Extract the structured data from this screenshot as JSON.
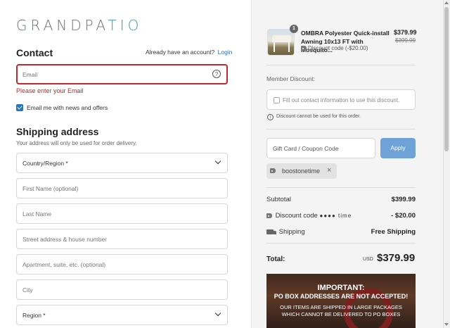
{
  "logo": {
    "text_main": "GRANDPA",
    "text_accent": "TIO"
  },
  "contact": {
    "title": "Contact",
    "already_text": "Already have an account?",
    "login_link": "Login",
    "email_placeholder": "Email",
    "error_message": "Please enter your Email",
    "newsletter_label": "Email me with news and offers",
    "newsletter_checked": true
  },
  "shipping": {
    "title": "Shipping address",
    "note": "Your address will only be used for order delivery.",
    "fields": {
      "country": "Country/Region *",
      "first_name": "First Name (optional)",
      "last_name": "Last Name",
      "street": "Street address & house number",
      "apartment": "Apartment, suite, etc. (optional)",
      "city": "City",
      "region": "Region *"
    }
  },
  "order": {
    "product": {
      "quantity": "1",
      "name": "OMBRA Polyester Quick-install Awning 10x13 FT with Mosquito...",
      "discount_line": "Discount code (-$20.00)",
      "price": "$379.99",
      "original_price": "$399.99"
    },
    "member_discount": {
      "label": "Member Discount:",
      "checkbox_text": "Fill out contact information to use this discount.",
      "info": "Discount cannot be used for this order."
    },
    "coupon": {
      "placeholder": "Gift Card / Coupon Code",
      "apply_label": "Apply",
      "applied_code": "boostonetime",
      "remove": "×"
    },
    "summary": {
      "subtotal_label": "Subtotal",
      "subtotal_value": "$399.99",
      "discount_label": "Discount code",
      "discount_masked": "●●●● time",
      "discount_value": "- $20.00",
      "shipping_label": "Shipping",
      "shipping_value": "Free Shipping",
      "total_label": "Total:",
      "currency": "USD",
      "total_value": "$379.99"
    },
    "banner": {
      "line1": "IMPORTANT:",
      "line2": "PO BOX ADDRESSES ARE NOT ACCEPTED!",
      "line3": "OUR ITEMS ARE SHIPPED IN LARGE PACKAGES",
      "line4": "WHICH CANNOT BE DELIVERED TO PO BOXES"
    }
  },
  "colors": {
    "error": "#c0282d",
    "link": "#2b6cb0",
    "apply_button": "#6fa3d8",
    "logo_accent": "#3a9a9a"
  }
}
